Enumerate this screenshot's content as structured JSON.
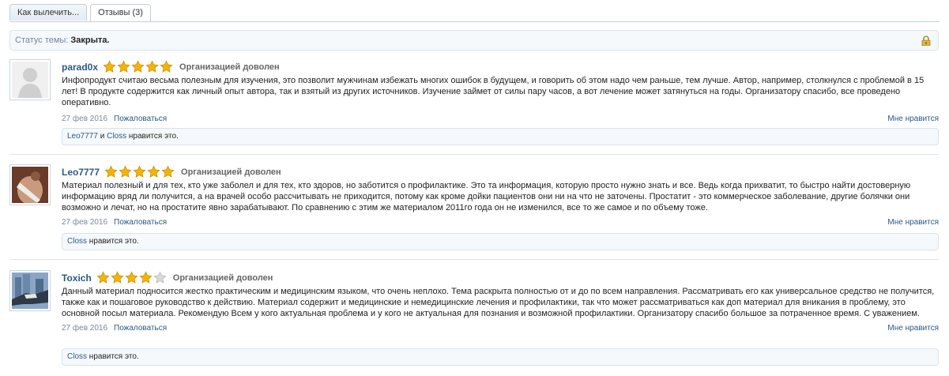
{
  "tabs": [
    {
      "label": "Как вылечить..."
    },
    {
      "label": "Отзывы (3)"
    }
  ],
  "status": {
    "label": "Статус темы:",
    "value": "Закрыта."
  },
  "colors": {
    "accent": "#2a5a8a",
    "star_on": "#f4b400",
    "star_off": "#d9d9d9"
  },
  "posts": [
    {
      "user": "parad0x",
      "rating": 5,
      "verdict": "Организацией доволен",
      "text": "Инфопродукт считаю весьма полезным для изучения, это позволит мужчинам избежать многих ошибок в будущем, и говорить об этом надо чем раньше, тем лучше. Автор, например, столкнулся с проблемой в 15 лет! В продукте содержится как личный опыт автора, так и взятый из других источников. Изучение займет от силы пару часов, а вот лечение может затянуться на годы. Организатору спасибо, все проведено оперативно.",
      "date": "27 фев 2016",
      "report": "Пожаловаться",
      "like": "Мне нравится",
      "likes_users": [
        "Leo7777",
        "Closs"
      ],
      "likes_joiner": "и",
      "likes_suffix": "нравится это."
    },
    {
      "user": "Leo7777",
      "rating": 5,
      "verdict": "Организацией доволен",
      "text": "Материал полезный и для тех, кто уже заболел и для тех, кто здоров, но заботится о профилактике. Это та информация, которую просто нужно знать и все. Ведь когда прихватит, то быстро найти достоверную информацию вряд ли получится, а на врачей особо рассчитывать не приходится, потому как кроме дойки пациентов они ни на что не заточены. Простатит - это коммерческое заболевание, другие болячки они возможно и лечат, но на простатите явно зарабатывают. По сравнению с этим же материалом 2011го года он не изменился, все то же самое и по объему тоже.",
      "date": "27 фев 2016",
      "report": "Пожаловаться",
      "like": "Мне нравится",
      "likes_users": [
        "Closs"
      ],
      "likes_joiner": "",
      "likes_suffix": "нравится это."
    },
    {
      "user": "Toxich",
      "rating": 4,
      "verdict": "Организацией доволен",
      "text": "Данный материал подносится жестко практическим и медицинским языком, что очень неплохо. Тема раскрыта полностью от и до по всем направления. Рассматривать его как универсальное средство не получится, также как и пошаговое руководство к действию. Материал содержит и медицинские и немедицинские лечения и профилактики, так что может рассматриваться как доп материал для вникания в проблему, это основной посыл материала. Рекомендую Всем у кого актуальная проблема и у кого не актуальная для познания и возможной профилактики. Организатору спасибо большое за потраченное время. С уважением.",
      "date": "27 фев 2016",
      "report": "Пожаловаться",
      "like": "Мне нравится",
      "likes_users": [
        "Closs"
      ],
      "likes_joiner": "",
      "likes_suffix": "нравится это."
    }
  ]
}
